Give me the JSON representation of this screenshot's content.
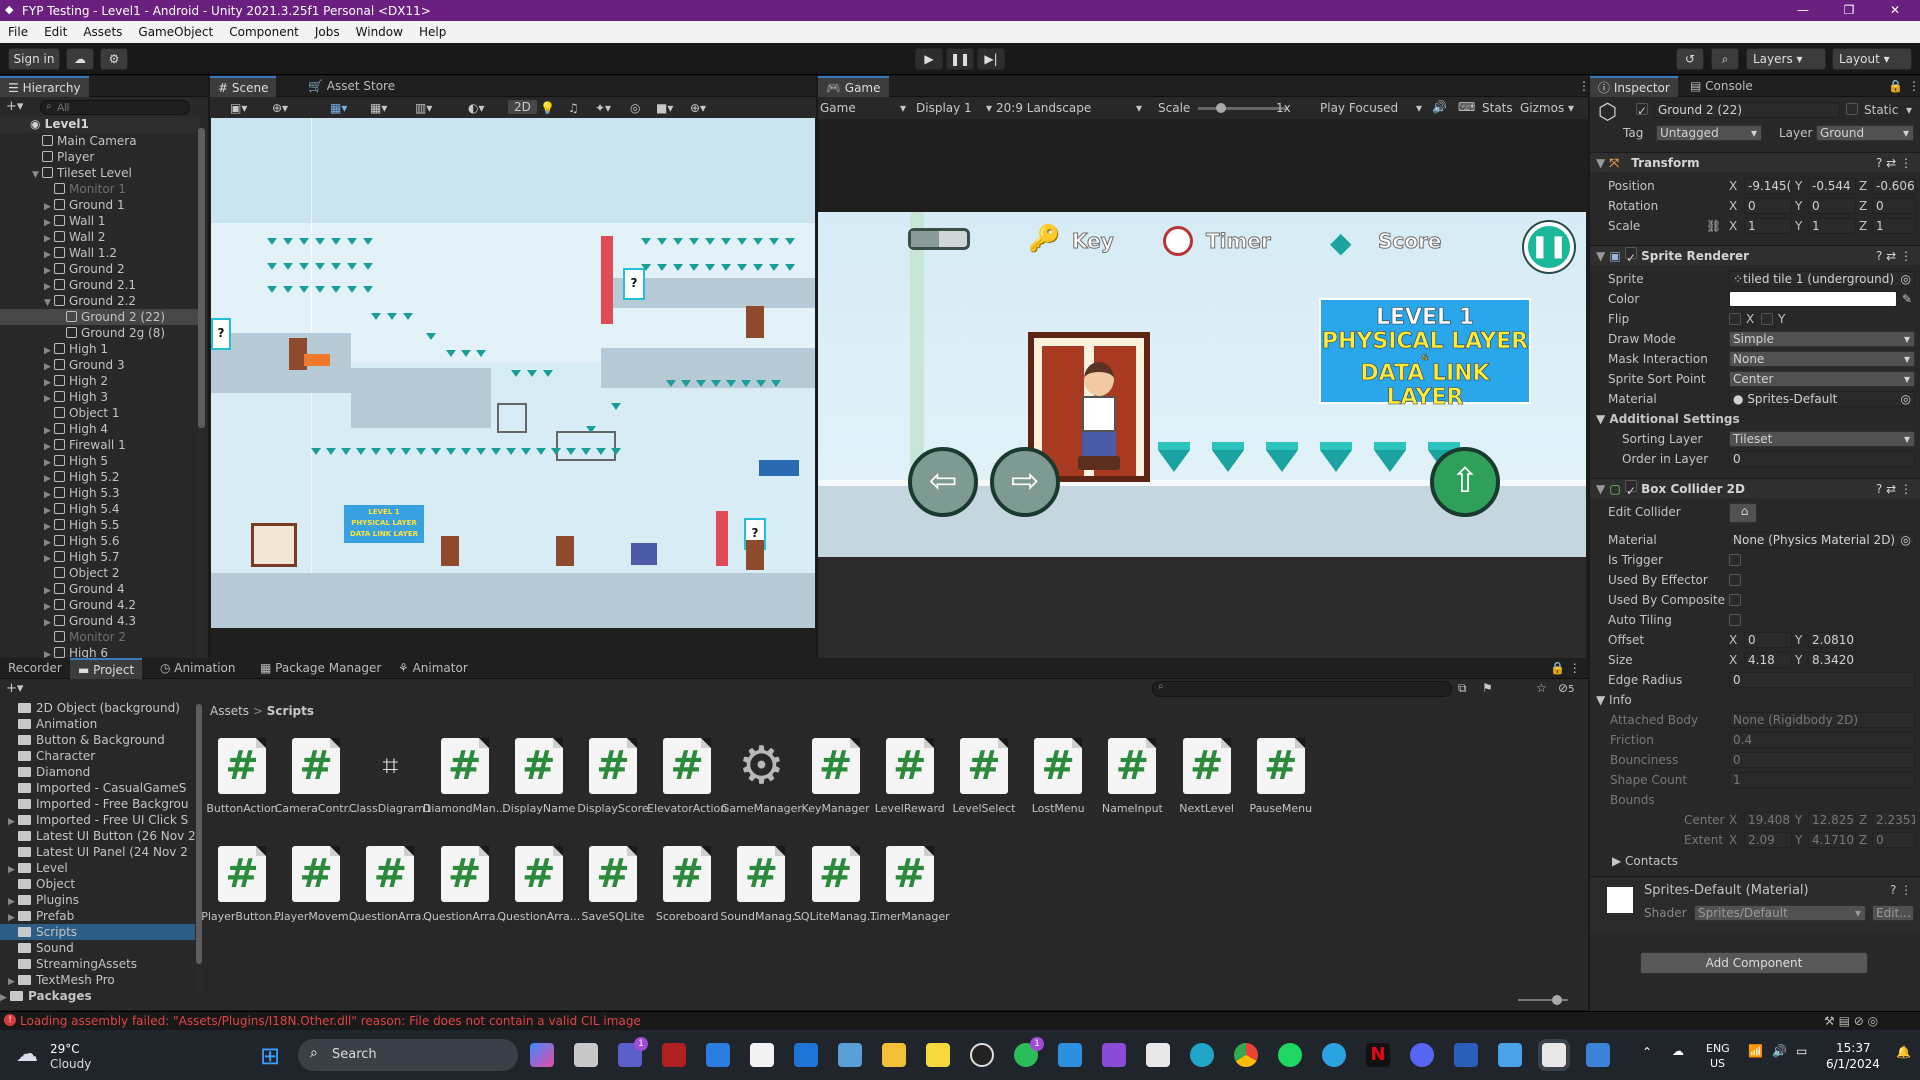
{
  "window": {
    "title": "FYP Testing - Level1 - Android - Unity 2021.3.25f1 Personal <DX11>",
    "controls": [
      "—",
      "❐",
      "✕"
    ]
  },
  "menu": [
    "File",
    "Edit",
    "Assets",
    "GameObject",
    "Component",
    "Jobs",
    "Window",
    "Help"
  ],
  "toolbar": {
    "sign_in": "Sign in",
    "layers": "Layers",
    "layout": "Layout"
  },
  "hierarchy": {
    "tab": "Hierarchy",
    "search_placeholder": "All",
    "scene": "Level1",
    "items": [
      {
        "label": "Main Camera",
        "indent": 2,
        "arrow": "",
        "dim": false
      },
      {
        "label": "Player",
        "indent": 2,
        "arrow": "",
        "dim": false
      },
      {
        "label": "Tileset Level",
        "indent": 2,
        "arrow": "▼",
        "dim": false
      },
      {
        "label": "Monitor 1",
        "indent": 3,
        "arrow": "",
        "dim": true
      },
      {
        "label": "Ground 1",
        "indent": 3,
        "arrow": "▶",
        "dim": false
      },
      {
        "label": "Wall 1",
        "indent": 3,
        "arrow": "▶",
        "dim": false
      },
      {
        "label": "Wall 2",
        "indent": 3,
        "arrow": "▶",
        "dim": false
      },
      {
        "label": "Wall 1.2",
        "indent": 3,
        "arrow": "▶",
        "dim": false
      },
      {
        "label": "Ground 2",
        "indent": 3,
        "arrow": "▶",
        "dim": false
      },
      {
        "label": "Ground 2.1",
        "indent": 3,
        "arrow": "▶",
        "dim": false
      },
      {
        "label": "Ground 2.2",
        "indent": 3,
        "arrow": "▼",
        "dim": false
      },
      {
        "label": "Ground 2 (22)",
        "indent": 4,
        "arrow": "",
        "dim": false,
        "selected": true
      },
      {
        "label": "Ground 2g (8)",
        "indent": 4,
        "arrow": "",
        "dim": false
      },
      {
        "label": "High 1",
        "indent": 3,
        "arrow": "▶",
        "dim": false
      },
      {
        "label": "Ground 3",
        "indent": 3,
        "arrow": "▶",
        "dim": false
      },
      {
        "label": "High 2",
        "indent": 3,
        "arrow": "▶",
        "dim": false
      },
      {
        "label": "High 3",
        "indent": 3,
        "arrow": "▶",
        "dim": false
      },
      {
        "label": "Object 1",
        "indent": 3,
        "arrow": "",
        "dim": false
      },
      {
        "label": "High 4",
        "indent": 3,
        "arrow": "▶",
        "dim": false
      },
      {
        "label": "Firewall 1",
        "indent": 3,
        "arrow": "▶",
        "dim": false
      },
      {
        "label": "High 5",
        "indent": 3,
        "arrow": "▶",
        "dim": false
      },
      {
        "label": "High 5.2",
        "indent": 3,
        "arrow": "▶",
        "dim": false
      },
      {
        "label": "High 5.3",
        "indent": 3,
        "arrow": "▶",
        "dim": false
      },
      {
        "label": "High 5.4",
        "indent": 3,
        "arrow": "▶",
        "dim": false
      },
      {
        "label": "High 5.5",
        "indent": 3,
        "arrow": "▶",
        "dim": false
      },
      {
        "label": "High 5.6",
        "indent": 3,
        "arrow": "▶",
        "dim": false
      },
      {
        "label": "High 5.7",
        "indent": 3,
        "arrow": "▶",
        "dim": false
      },
      {
        "label": "Object 2",
        "indent": 3,
        "arrow": "",
        "dim": false
      },
      {
        "label": "Ground 4",
        "indent": 3,
        "arrow": "▶",
        "dim": false
      },
      {
        "label": "Ground 4.2",
        "indent": 3,
        "arrow": "▶",
        "dim": false
      },
      {
        "label": "Ground 4.3",
        "indent": 3,
        "arrow": "▶",
        "dim": false
      },
      {
        "label": "Monitor 2",
        "indent": 3,
        "arrow": "",
        "dim": true
      },
      {
        "label": "High 6",
        "indent": 3,
        "arrow": "▶",
        "dim": false
      }
    ]
  },
  "scene": {
    "tabs": [
      "Scene",
      "Asset Store"
    ],
    "mode_2d": "2D"
  },
  "game": {
    "tab": "Game",
    "view_select": "Game",
    "display": "Display 1",
    "aspect": "20:9 Landscape",
    "scale_label": "Scale",
    "scale_value": "1x",
    "play_mode": "Play Focused",
    "stats": "Stats",
    "gizmos": "Gizmos",
    "hud": {
      "key": "Key",
      "timer": "Timer",
      "score": "Score"
    },
    "banner": [
      "LEVEL 1",
      "PHYSICAL LAYER",
      "&",
      "DATA LINK LAYER"
    ]
  },
  "inspector": {
    "tabs": [
      "Inspector",
      "Console"
    ],
    "object_name": "Ground 2 (22)",
    "static_label": "Static",
    "tag_label": "Tag",
    "tag_value": "Untagged",
    "layer_label": "Layer",
    "layer_value": "Ground",
    "transform": {
      "title": "Transform",
      "position": {
        "label": "Position",
        "x": "-9.145(",
        "y": "-0.544",
        "z": "-0.606"
      },
      "rotation": {
        "label": "Rotation",
        "x": "0",
        "y": "0",
        "z": "0"
      },
      "scale": {
        "label": "Scale",
        "x": "1",
        "y": "1",
        "z": "1"
      }
    },
    "sprite_renderer": {
      "title": "Sprite Renderer",
      "sprite_label": "Sprite",
      "sprite_value": "tiled tile 1 (underground)",
      "color_label": "Color",
      "flip_label": "Flip",
      "flip_x": "X",
      "flip_y": "Y",
      "draw_mode_label": "Draw Mode",
      "draw_mode_value": "Simple",
      "mask_label": "Mask Interaction",
      "mask_value": "None",
      "sort_point_label": "Sprite Sort Point",
      "sort_point_value": "Center",
      "material_label": "Material",
      "material_value": "Sprites-Default",
      "additional": "Additional Settings",
      "sorting_layer_label": "Sorting Layer",
      "sorting_layer_value": "Tileset",
      "order_label": "Order in Layer",
      "order_value": "0"
    },
    "box_collider": {
      "title": "Box Collider 2D",
      "edit_label": "Edit Collider",
      "material_label": "Material",
      "material_value": "None (Physics Material 2D)",
      "is_trigger": "Is Trigger",
      "used_effector": "Used By Effector",
      "used_composite": "Used By Composite",
      "auto_tiling": "Auto Tiling",
      "offset_label": "Offset",
      "offset_x": "0",
      "offset_y": "2.0810",
      "size_label": "Size",
      "size_x": "4.18",
      "size_y": "8.3420",
      "edge_label": "Edge Radius",
      "edge_value": "0",
      "info": "Info",
      "attached_label": "Attached Body",
      "attached_value": "None (Rigidbody 2D)",
      "friction_label": "Friction",
      "friction_value": "0.4",
      "bounciness_label": "Bounciness",
      "bounciness_value": "0",
      "shape_label": "Shape Count",
      "shape_value": "1",
      "bounds_label": "Bounds",
      "center_label": "Center",
      "center_x": "19.408",
      "center_y": "12.825",
      "center_z": "2.2351",
      "extent_label": "Extent",
      "extent_x": "2.09",
      "extent_y": "4.1710",
      "extent_z": "0",
      "contacts": "Contacts"
    },
    "material": {
      "name": "Sprites-Default (Material)",
      "shader_label": "Shader",
      "shader_value": "Sprites/Default",
      "edit": "Edit..."
    },
    "add_component": "Add Component"
  },
  "bottom_tabs": [
    "Recorder",
    "Project",
    "Animation",
    "Package Manager",
    "Animator"
  ],
  "project": {
    "hidden_count": "5",
    "breadcrumb": [
      "Assets",
      "Scripts"
    ],
    "folders": [
      {
        "label": "2D Object (background)",
        "arrow": ""
      },
      {
        "label": "Animation",
        "arrow": ""
      },
      {
        "label": "Button & Background",
        "arrow": ""
      },
      {
        "label": "Character",
        "arrow": ""
      },
      {
        "label": "Diamond",
        "arrow": ""
      },
      {
        "label": "Imported -  CasualGameS",
        "arrow": ""
      },
      {
        "label": "Imported - Free Backgrou",
        "arrow": ""
      },
      {
        "label": "Imported - Free UI Click S",
        "arrow": "▶"
      },
      {
        "label": "Latest UI Button (26 Nov 2",
        "arrow": ""
      },
      {
        "label": "Latest UI Panel (24 Nov 2",
        "arrow": ""
      },
      {
        "label": "Level",
        "arrow": "▶"
      },
      {
        "label": "Object",
        "arrow": ""
      },
      {
        "label": "Plugins",
        "arrow": "▶"
      },
      {
        "label": "Prefab",
        "arrow": "▶"
      },
      {
        "label": "Scripts",
        "arrow": "",
        "selected": true
      },
      {
        "label": "Sound",
        "arrow": ""
      },
      {
        "label": "StreamingAssets",
        "arrow": ""
      },
      {
        "label": "TextMesh Pro",
        "arrow": "▶"
      }
    ],
    "packages": "Packages",
    "assets_row1": [
      "ButtonAction",
      "CameraContr...",
      "ClassDiagram1",
      "DiamondMan...",
      "DisplayName",
      "DisplayScore",
      "ElevatorAction",
      "GameManager",
      "KeyManager",
      "LevelReward",
      "LevelSelect",
      "LostMenu",
      "NameInput",
      "NextLevel",
      "PauseMenu"
    ],
    "assets_row2": [
      "PlayerButton...",
      "PlayerMovem...",
      "QuestionArra...",
      "QuestionArra...",
      "QuestionArra...",
      "SaveSQLite",
      "Scoreboard",
      "SoundManag...",
      "SQLiteManag...",
      "TimerManager"
    ]
  },
  "status": {
    "error": "Loading assembly failed: \"Assets/Plugins/I18N.Other.dll\" reason: File does not contain a valid CIL image"
  },
  "taskbar": {
    "weather_temp": "29°C",
    "weather_desc": "Cloudy",
    "search": "Search",
    "lang": "ENG",
    "region": "US",
    "time": "15:37",
    "date": "6/1/2024",
    "teams_badge": "1",
    "whatsapp_badge": "1"
  }
}
